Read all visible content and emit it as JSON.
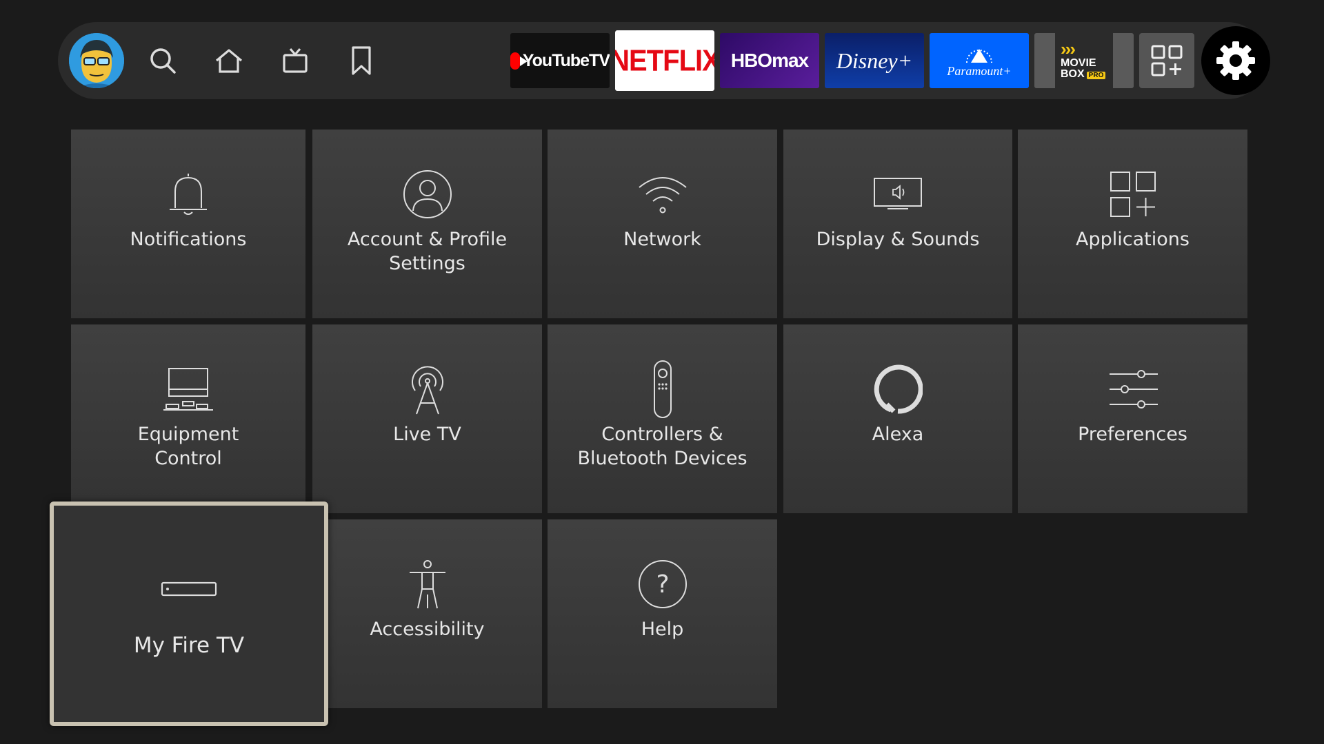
{
  "topbar": {
    "profile": {
      "name": "profile-avatar"
    },
    "nav": [
      {
        "name": "search-icon"
      },
      {
        "name": "home-icon"
      },
      {
        "name": "live-tv-icon"
      },
      {
        "name": "watchlist-icon"
      }
    ],
    "apps": [
      {
        "label": "YouTubeTV"
      },
      {
        "label": "NETFLIX"
      },
      {
        "label": "HBOmax"
      },
      {
        "label": "Disney+"
      },
      {
        "label": "Paramount+"
      },
      {
        "label_line1": "MOVIE",
        "label_line2": "BOX",
        "badge": "PRO"
      }
    ]
  },
  "settings_tiles": [
    {
      "label": "Notifications",
      "icon": "bell-icon"
    },
    {
      "label": "Account & Profile Settings",
      "icon": "person-icon"
    },
    {
      "label": "Network",
      "icon": "wifi-icon"
    },
    {
      "label": "Display & Sounds",
      "icon": "display-sound-icon"
    },
    {
      "label": "Applications",
      "icon": "apps-grid-icon"
    },
    {
      "label": "Equipment Control",
      "icon": "equipment-icon"
    },
    {
      "label": "Live TV",
      "icon": "antenna-icon"
    },
    {
      "label": "Controllers & Bluetooth Devices",
      "icon": "remote-icon"
    },
    {
      "label": "Alexa",
      "icon": "alexa-icon"
    },
    {
      "label": "Preferences",
      "icon": "sliders-icon"
    },
    {
      "label": "My Fire TV",
      "icon": "fire-tv-device-icon"
    },
    {
      "label": "Accessibility",
      "icon": "accessibility-icon"
    },
    {
      "label": "Help",
      "icon": "help-icon"
    }
  ],
  "focused_tile": "My Fire TV",
  "colors": {
    "background": "#1b1b1b",
    "topbar": "#2b2b2b",
    "tile": "#3a3a3a",
    "focus_border": "#c9c2b1"
  }
}
